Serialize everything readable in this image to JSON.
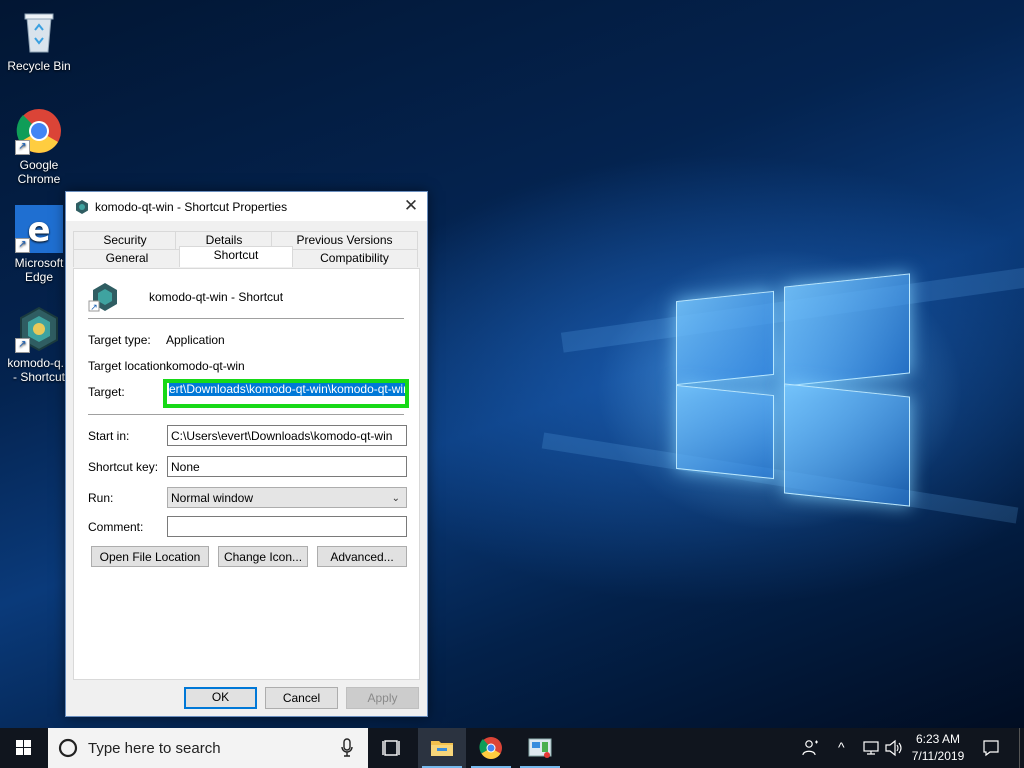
{
  "desktop": {
    "icons": [
      {
        "label_lines": [
          "Recycle Bin"
        ],
        "icon": "recycle-bin-icon"
      },
      {
        "label_lines": [
          "Google",
          "Chrome"
        ],
        "icon": "chrome-icon"
      },
      {
        "label_lines": [
          "Microsoft",
          "Edge"
        ],
        "icon": "edge-icon"
      },
      {
        "label_lines": [
          "komodo-q...",
          "- Shortcut"
        ],
        "icon": "komodo-icon"
      }
    ]
  },
  "dialog": {
    "title": "komodo-qt-win - Shortcut Properties",
    "tabs_top": [
      "Security",
      "Details",
      "Previous Versions"
    ],
    "tabs_bottom": [
      "General",
      "Shortcut",
      "Compatibility"
    ],
    "active_tab": "Shortcut",
    "shortcut_name": "komodo-qt-win - Shortcut",
    "target_type_label": "Target type:",
    "target_type_value": "Application",
    "target_location_label": "Target location:",
    "target_location_value": "komodo-qt-win",
    "target_label": "Target:",
    "target_value": "ert\\Downloads\\komodo-qt-win\\komodo-qt-win.exe",
    "start_in_label": "Start in:",
    "start_in_value": "C:\\Users\\evert\\Downloads\\komodo-qt-win",
    "shortcut_key_label": "Shortcut key:",
    "shortcut_key_value": "None",
    "run_label": "Run:",
    "run_value": "Normal window",
    "comment_label": "Comment:",
    "comment_value": "",
    "open_file_location": "Open File Location",
    "change_icon": "Change Icon...",
    "advanced": "Advanced...",
    "ok": "OK",
    "cancel": "Cancel",
    "apply": "Apply"
  },
  "taskbar": {
    "search_placeholder": "Type here to search",
    "time": "6:23 AM",
    "date": "7/11/2019"
  },
  "colors": {
    "highlight_border": "#17d917",
    "selection": "#0078d7",
    "taskbar": "#10151e"
  }
}
